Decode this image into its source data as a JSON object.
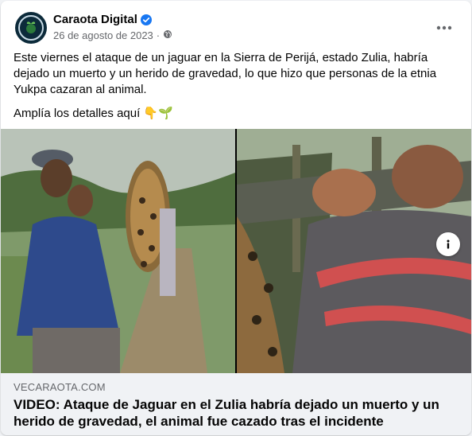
{
  "post": {
    "page_name": "Caraota Digital",
    "date": "26 de agosto de 2023",
    "dot": "·",
    "text_1": "Este viernes el ataque de un jaguar en la Sierra de Perijá, estado Zulia, habría dejado un muerto y un herido de gravedad, lo que hizo que personas de la etnia Yukpa cazaran al animal.",
    "text_2": "Amplía los detalles aquí 👇🌱"
  },
  "link_preview": {
    "domain": "VECARAOTA.COM",
    "headline": "VIDEO: Ataque de Jaguar en el Zulia habría dejado un muerto y un herido de gravedad, el animal fue cazado tras el incidente"
  },
  "icons": {
    "verified": "verified-badge-icon",
    "audience": "globe-icon",
    "more": "more-options-icon",
    "info": "info-icon"
  },
  "colors": {
    "verified": "#1877f2",
    "secondary_text": "#65676b",
    "link_background": "#f0f2f5"
  }
}
